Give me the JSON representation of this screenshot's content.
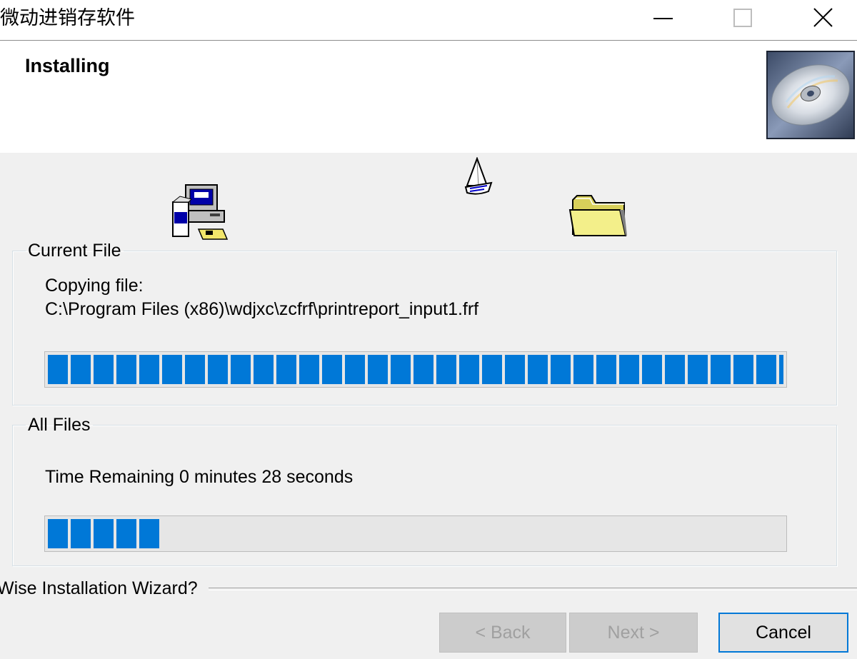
{
  "window": {
    "title": "微动进销存软件"
  },
  "header": {
    "title": "Installing",
    "icon": "cd-disc-icon"
  },
  "current_file": {
    "legend": "Current File",
    "line1": "Copying file:",
    "line2": "C:\\Program Files (x86)\\wdjxc\\zcfrf\\printreport_input1.frf",
    "progress": 1.0
  },
  "all_files": {
    "legend": "All Files",
    "time_remaining": "Time Remaining 0 minutes 28 seconds",
    "progress": 0.15
  },
  "footer": {
    "wizard_label": "Wise Installation Wizard?"
  },
  "buttons": {
    "back": "< Back",
    "next": "Next >",
    "cancel": "Cancel"
  },
  "colors": {
    "progress": "#0078d7",
    "background": "#f0f0f0"
  }
}
